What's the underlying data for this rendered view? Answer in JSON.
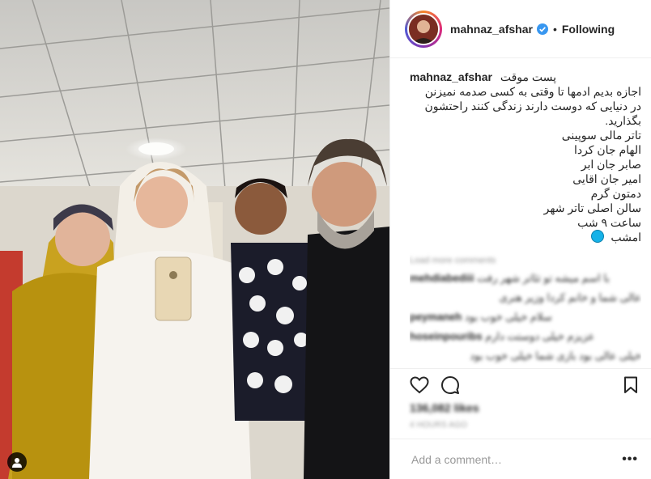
{
  "post": {
    "username": "mahnaz_afshar",
    "follow_status": "Following",
    "separator": "•"
  },
  "caption": {
    "username": "mahnaz_afshar",
    "lines": [
      "پست موقت",
      "اجازه بدیم ادمها تا وقتی به کسی صدمه نمیزنن",
      "در دنیایی که دوست دارند زندگی کنند راحتشون",
      "بگذارید.",
      "تاتر مالی سوپینی",
      "الهام جان کردا",
      "صابر جان ابر",
      "امیر جان اقایی",
      "دمتون گرم",
      "سالن اصلی تاتر شهر",
      "ساعت ۹ شب",
      "امشب"
    ]
  },
  "comments": {
    "load_more": "Load more comments",
    "items": [
      {
        "user": "mehdiabediii",
        "text": "با اسم میشه تو تئاتر شهر رفت"
      },
      {
        "user": "",
        "text": "عالی شما و خانم کردا وزیر هنری"
      },
      {
        "user": "peymaneh",
        "text": "سلام خیلی خوب بود"
      },
      {
        "user": "hoseinpouribs",
        "text": "عزیزم خیلی دوستت دارم"
      },
      {
        "user": "",
        "text": "خیلی عالی بود بازی شما خیلی خوب بود"
      }
    ]
  },
  "stats": {
    "likes": "136,082 likes",
    "time": "4 HOURS AGO"
  },
  "add_comment": {
    "placeholder": "Add a comment…",
    "more": "•••"
  }
}
